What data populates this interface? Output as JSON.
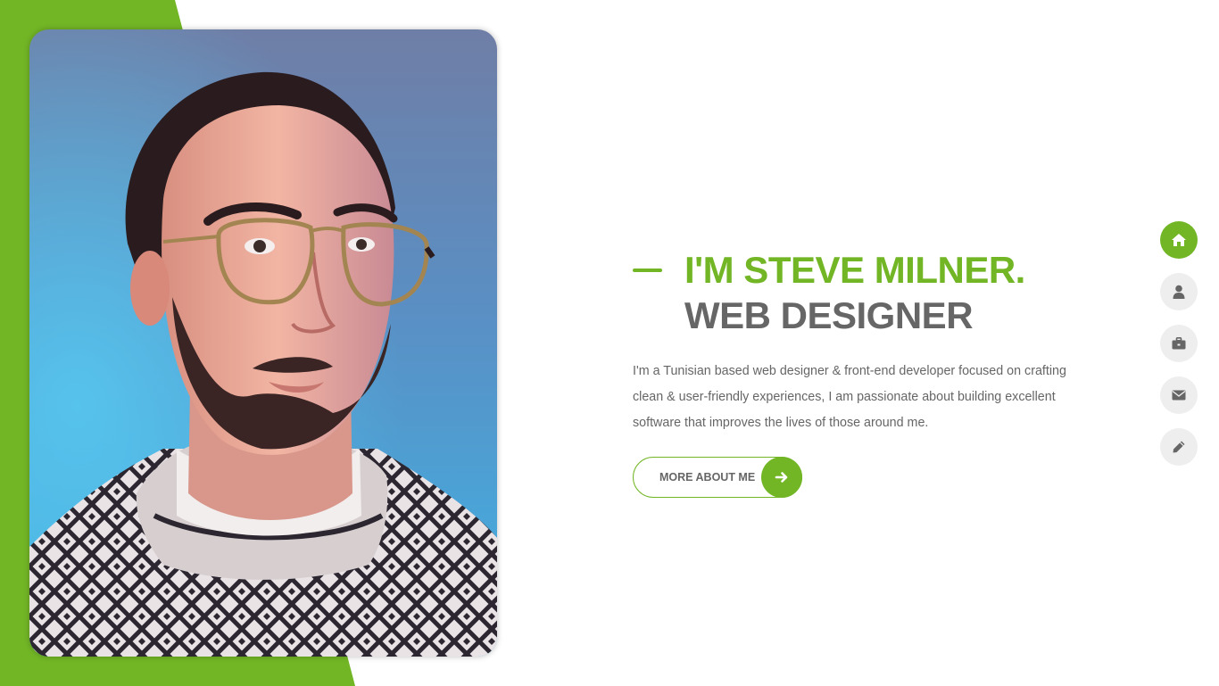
{
  "colors": {
    "accent": "#72b626",
    "heading_dark": "#666666",
    "text": "#666666",
    "nav_inactive_bg": "#eeeeee",
    "nav_inactive_icon": "#666666",
    "white": "#ffffff"
  },
  "hero": {
    "photo_alt": "Portrait of Steve Milner",
    "title_line1": "I'M STEVE MILNER.",
    "title_line2": "WEB DESIGNER",
    "bio": "I'm a Tunisian based web designer & front-end developer focused on crafting clean & user-friendly experiences, I am passionate about building excellent software that improves the lives of those around me.",
    "button_label": "MORE ABOUT ME",
    "button_icon": "arrow-right-icon"
  },
  "side_nav": {
    "items": [
      {
        "icon": "home-icon",
        "active": true
      },
      {
        "icon": "user-icon",
        "active": false
      },
      {
        "icon": "briefcase-icon",
        "active": false
      },
      {
        "icon": "envelope-icon",
        "active": false
      },
      {
        "icon": "pencil-icon",
        "active": false
      }
    ]
  }
}
